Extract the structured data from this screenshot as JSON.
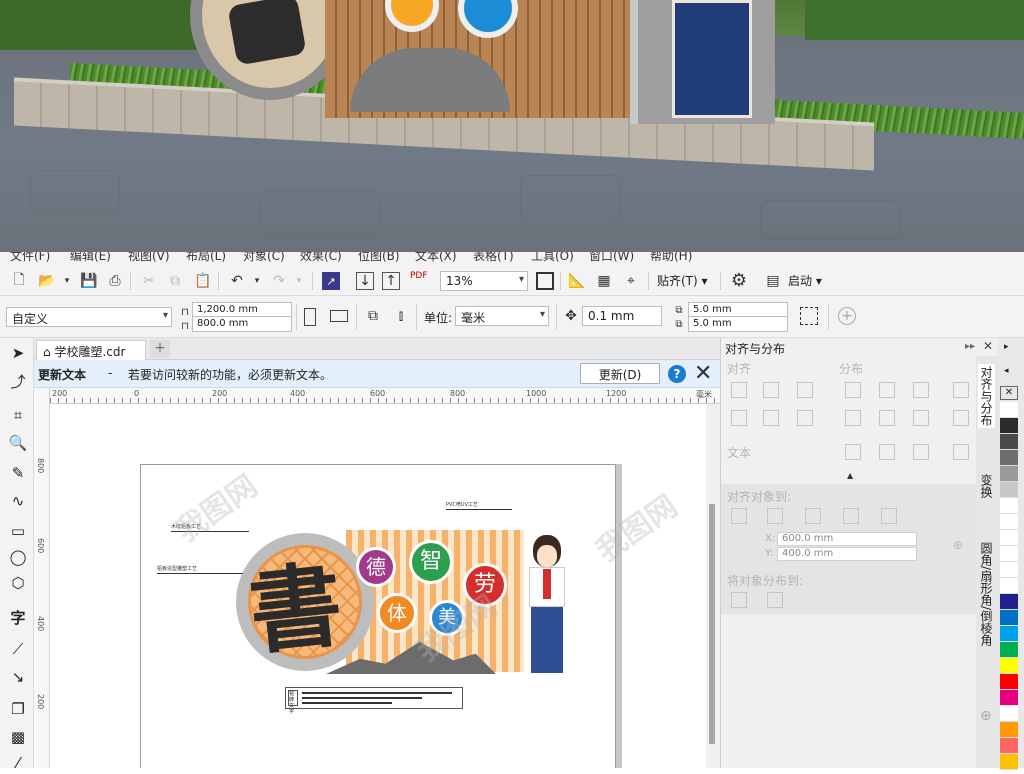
{
  "menu": [
    "文件(F)",
    "编辑(E)",
    "视图(V)",
    "布局(L)",
    "对象(C)",
    "效果(C)",
    "位图(B)",
    "文本(X)",
    "表格(T)",
    "工具(O)",
    "窗口(W)",
    "帮助(H)"
  ],
  "toolbar1": {
    "pdf_label": "PDF",
    "zoom": "13%",
    "snap_label": "贴齐(T)",
    "launch_label": "启动"
  },
  "toolbar2": {
    "preset": "自定义",
    "width": "1,200.0 mm",
    "height": "800.0 mm",
    "unit_label": "单位:",
    "unit": "毫米",
    "nudge": "0.1 mm",
    "dup_x": "5.0 mm",
    "dup_y": "5.0 mm"
  },
  "doc_tab": {
    "name": "学校雕塑.cdr",
    "add": "+"
  },
  "infobar": {
    "title": "更新文本",
    "dash": "-",
    "message": "若要访问较新的功能，必须更新文本。",
    "button": "更新(D)",
    "help": "?"
  },
  "ruler": {
    "h": [
      "200",
      "0",
      "200",
      "400",
      "600",
      "800",
      "1000",
      "1200"
    ],
    "unit": "毫米",
    "v": [
      "800",
      "600",
      "400",
      "200"
    ]
  },
  "artwork": {
    "glyph_main": "書",
    "circles": [
      {
        "label": "德",
        "color": "#a23a8c"
      },
      {
        "label": "智",
        "color": "#2e9e4f"
      },
      {
        "label": "劳",
        "color": "#d62d2d"
      },
      {
        "label": "体",
        "color": "#f18a21"
      },
      {
        "label": "美",
        "color": "#2b87d1"
      }
    ],
    "note_plaque": "铭牌文字",
    "callouts": [
      "木纹铝板工艺",
      "铝板造型雕塑工艺",
      "PVC喷UV工艺"
    ]
  },
  "docker": {
    "title": "对齐与分布",
    "section_align": "对齐",
    "section_distribute": "分布",
    "section_text": "文本",
    "align_to": "对齐对象到:",
    "x_value": "600.0 mm",
    "y_value": "400.0 mm",
    "distribute_to": "将对象分布到:"
  },
  "side_tabs": [
    "对齐与分布",
    "变换",
    "圆角/扇形角/倒棱角"
  ],
  "palette": [
    "#ffffff",
    "#2b2b2b",
    "#4a4a4a",
    "#6e6e6e",
    "#9a9a9a",
    "#c8c8c8",
    "#ffffff",
    "#1f1f8f",
    "#0070c0",
    "#00a0e9",
    "#00b050",
    "#ffff00",
    "#ffc000",
    "#ff0000",
    "#e4007f",
    "#ffffff",
    "#7030a0",
    "#00b0f0",
    "#92d050",
    "#ff9900",
    "#ff6666"
  ],
  "watermark": "我图网"
}
